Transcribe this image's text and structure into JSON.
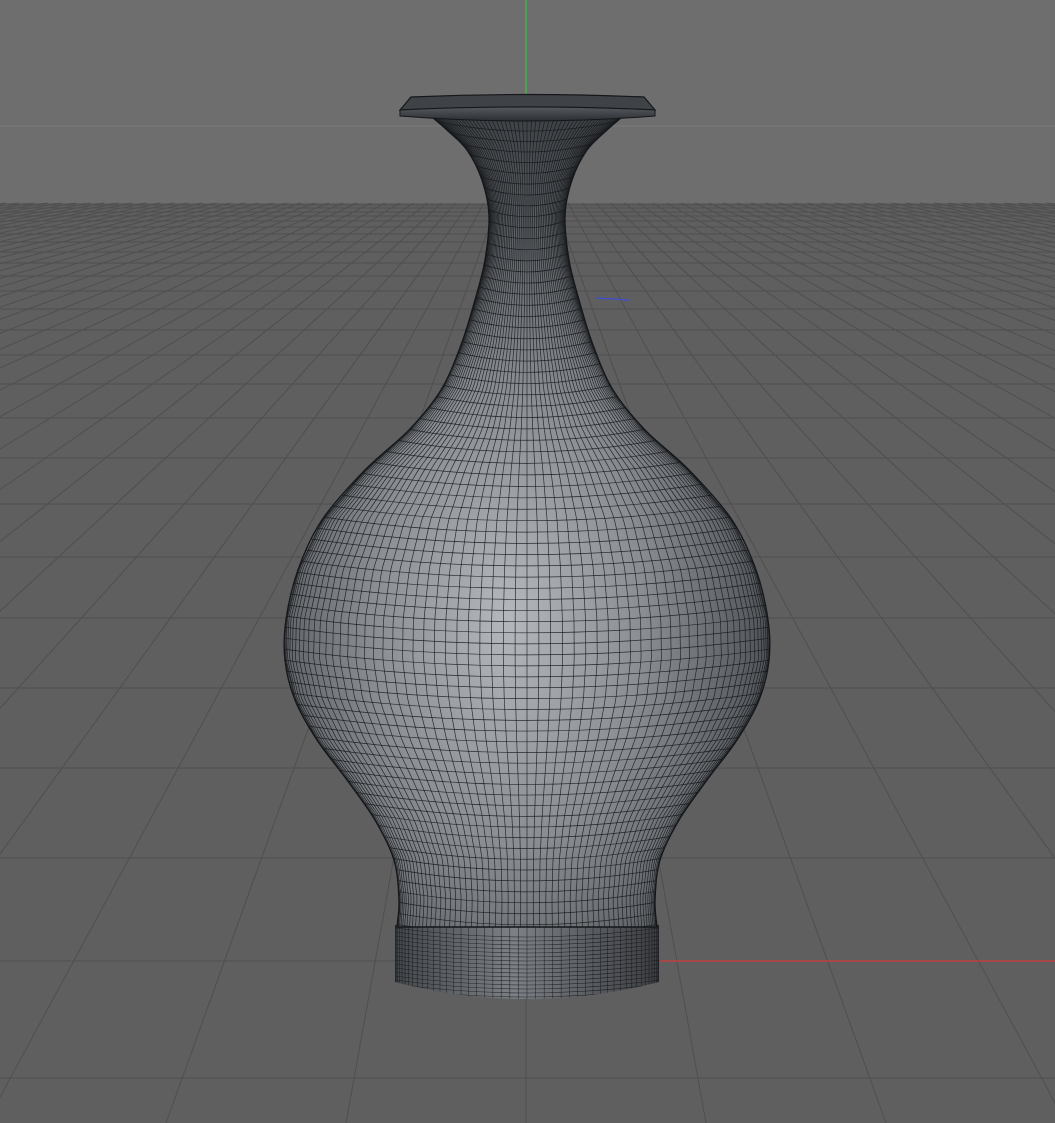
{
  "viewport": {
    "colors": {
      "background_upper": "#6e6e6e",
      "background_floor": "#5f5f5f",
      "grid_line": "#4f4f4f",
      "horizon_line": "#7a7a7a",
      "axis_x": "#d23a3a",
      "axis_y": "#3fbf4a",
      "axis_z": "#3d4fd6"
    }
  },
  "object": {
    "name_icon": "vase-mesh",
    "colors": {
      "surface_light": "#a9adb1",
      "surface_mid": "#7d8186",
      "surface_dark": "#3f4246",
      "wire": "#15171a"
    }
  }
}
